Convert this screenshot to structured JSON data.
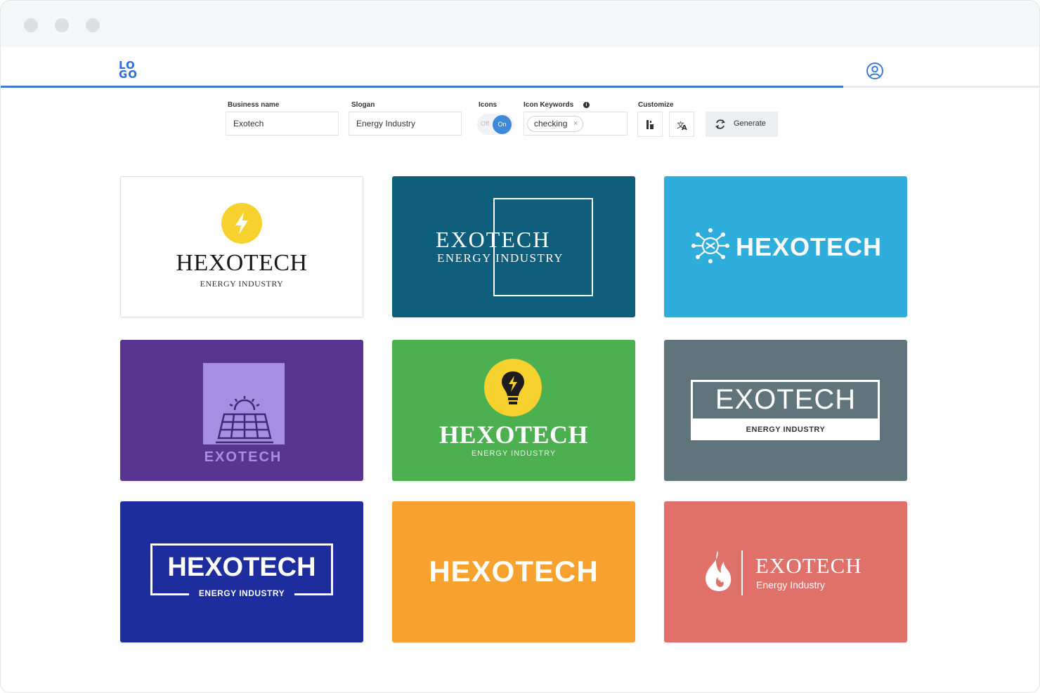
{
  "window": {
    "traffic_lights": [
      "close",
      "minimize",
      "maximize"
    ]
  },
  "header": {
    "logo_top": "LO",
    "logo_bottom": "GO",
    "progress_percent": 81
  },
  "form": {
    "business_name": {
      "label": "Business name",
      "value": "Exotech"
    },
    "slogan": {
      "label": "Slogan",
      "value": "Energy Industry"
    },
    "icons": {
      "label": "Icons",
      "off_label": "Off",
      "on_label": "On",
      "state": "on"
    },
    "icon_keywords": {
      "label": "Icon Keywords",
      "chips": [
        "checking"
      ]
    },
    "customize": {
      "label": "Customize"
    },
    "generate_label": "Generate"
  },
  "logos": [
    {
      "name": "HEXOTECH",
      "tagline": "ENERGY INDUSTRY",
      "bg": "#ffffff",
      "icon": "lightning-icon"
    },
    {
      "name": "EXOTECH",
      "tagline": "ENERGY INDUSTRY",
      "bg": "#0f5f7c",
      "icon": "none"
    },
    {
      "name": "HEXOTECH",
      "tagline": "",
      "bg": "#2faedb",
      "icon": "circuit-icon"
    },
    {
      "name": "EXOTECH",
      "tagline": "",
      "bg": "#5a3590",
      "icon": "solar-panel-icon"
    },
    {
      "name": "HEXOTECH",
      "tagline": "ENERGY INDUSTRY",
      "bg": "#4caf50",
      "icon": "lightbulb-icon"
    },
    {
      "name": "EXOTECH",
      "tagline": "ENERGY INDUSTRY",
      "bg": "#5f747b",
      "icon": "none"
    },
    {
      "name": "HEXOTECH",
      "tagline": "ENERGY INDUSTRY",
      "bg": "#1e2d9d",
      "icon": "none"
    },
    {
      "name": "HEXOTECH",
      "tagline": "",
      "bg": "#f7a12f",
      "icon": "none"
    },
    {
      "name": "EXOTECH",
      "tagline": "Energy Industry",
      "bg": "#e0706a",
      "icon": "flame-icon"
    }
  ],
  "colors": {
    "accent": "#3c7bd8",
    "toggle_on": "#3e8ad8",
    "flash_yellow": "#f7d22f"
  }
}
